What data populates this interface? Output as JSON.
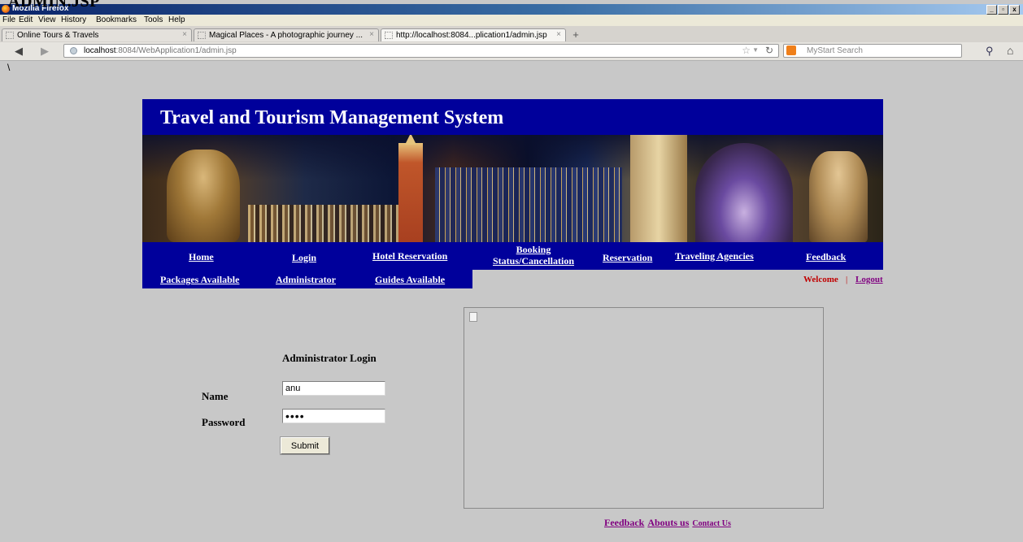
{
  "doc_heading": "ADMIN.JSP",
  "window": {
    "title": "Mozilla Firefox",
    "controls": [
      "_",
      "▫",
      "x"
    ]
  },
  "menu": [
    "File",
    "Edit",
    "View",
    "History",
    "Bookmarks",
    "Tools",
    "Help"
  ],
  "tabs": [
    {
      "label": "Online Tours & Travels",
      "active": false
    },
    {
      "label": "Magical Places - A photographic journey ...",
      "active": false
    },
    {
      "label": "http://localhost:8084...plication1/admin.jsp",
      "active": true
    }
  ],
  "url": {
    "host": "localhost",
    "rest": ":8084/WebApplication1/admin.jsp"
  },
  "search_placeholder": "MyStart Search",
  "stray_char": "\\",
  "site": {
    "title": "Travel and Tourism Management System",
    "nav1": {
      "home": "Home",
      "login": "Login",
      "hotel": "Hotel Reservation",
      "booking_line1": "Booking",
      "booking_line2": "Status/Cancellation",
      "reservation": "Reservation",
      "agencies": "Traveling Agencies",
      "feedback": "Feedback"
    },
    "nav2": {
      "packages": "Packages Available",
      "administrator": "Administrator",
      "guides": "Guides Available"
    },
    "welcome": "Welcome",
    "separator": "|",
    "logout": "Logout"
  },
  "form": {
    "title": "Administrator Login",
    "name_label": "Name",
    "name_value": "anu",
    "password_label": "Password",
    "password_value": "abcd",
    "submit_label": "Submit"
  },
  "footer": {
    "feedback": "Feedback",
    "about": "Abouts us",
    "contact": "Contact Us"
  }
}
